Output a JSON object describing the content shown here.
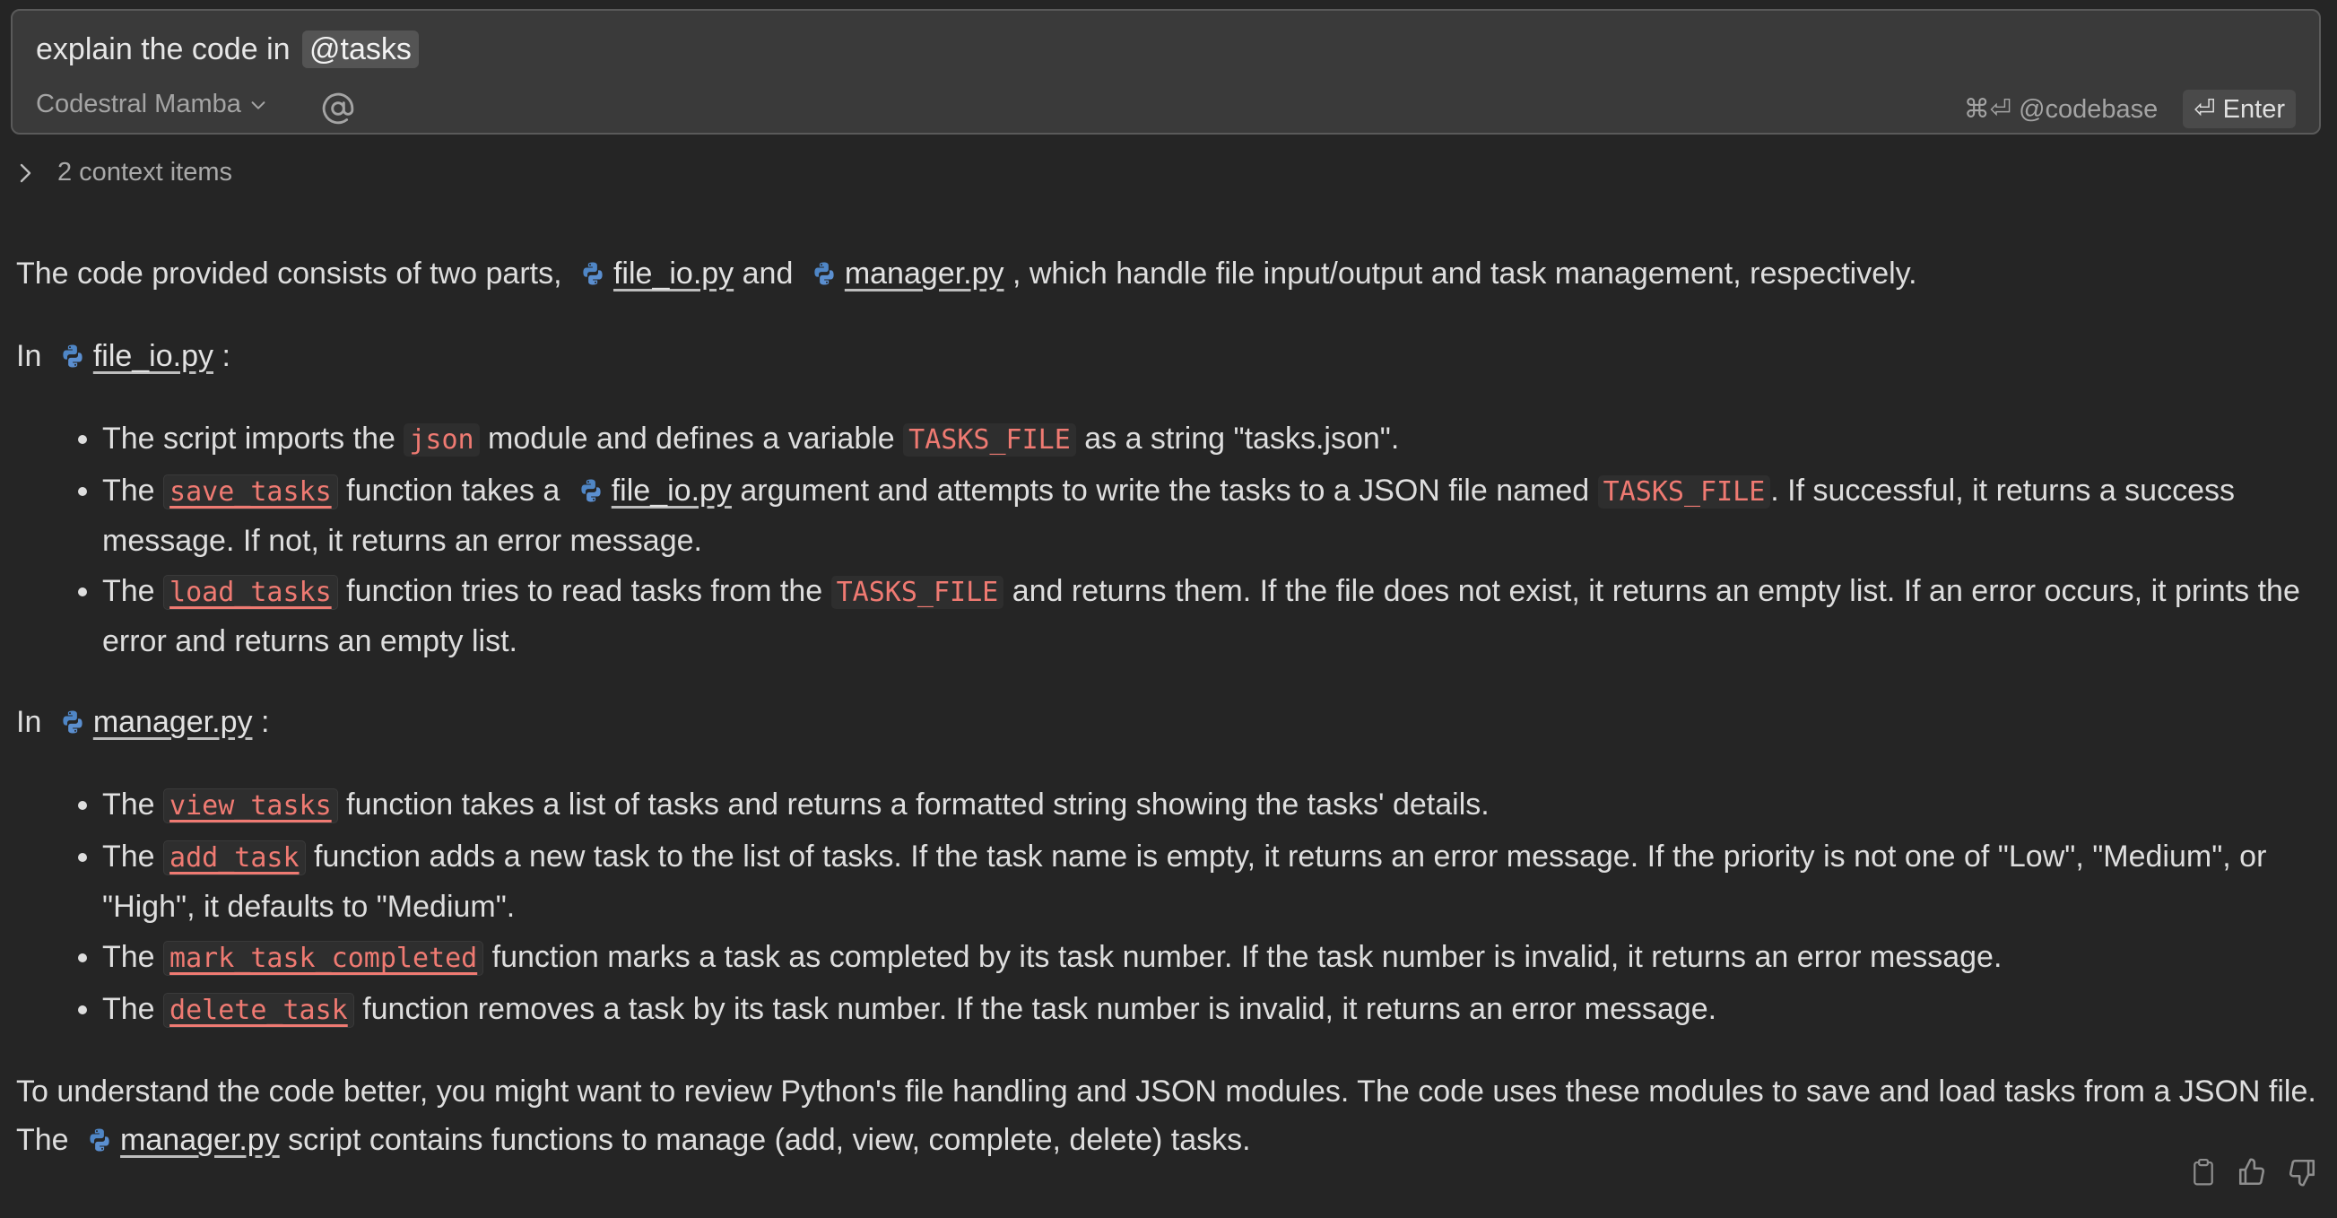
{
  "input": {
    "prompt_text": "explain the code in",
    "mention": "@tasks",
    "model": "Codestral Mamba",
    "at_symbol": "@",
    "codebase_shortcut": "⌘⏎ @codebase",
    "enter_label": "⏎ Enter"
  },
  "context": {
    "label": "2 context items"
  },
  "response": {
    "intro": {
      "a": "The code provided consists of two parts,",
      "file1": "file_io.py",
      "b": "and",
      "file2": "manager.py",
      "c": ", which handle file input/output and task management, respectively."
    },
    "section1": {
      "prefix": "In",
      "file": "file_io.py",
      "suffix": ":",
      "bullets": [
        {
          "t1": "The script imports the",
          "c1": "json",
          "t2": "module and defines a variable",
          "c2": "TASKS_FILE",
          "t3": "as a string \"tasks.json\"."
        },
        {
          "t1": "The",
          "c1": "save_tasks",
          "t2": "function takes a",
          "file": "file_io.py",
          "t3": "argument and attempts to write the tasks to a JSON file named",
          "c2": "TASKS_FILE",
          "t4": ". If successful, it returns a success message. If not, it returns an error message."
        },
        {
          "t1": "The",
          "c1": "load_tasks",
          "t2": "function tries to read tasks from the",
          "c2": "TASKS_FILE",
          "t3": "and returns them. If the file does not exist, it returns an empty list. If an error occurs, it prints the error and returns an empty list."
        }
      ]
    },
    "section2": {
      "prefix": "In",
      "file": "manager.py",
      "suffix": ":",
      "bullets": [
        {
          "t1": "The",
          "c1": "view_tasks",
          "t2": "function takes a list of tasks and returns a formatted string showing the tasks' details."
        },
        {
          "t1": "The",
          "c1": "add_task",
          "t2": "function adds a new task to the list of tasks. If the task name is empty, it returns an error message. If the priority is not one of \"Low\", \"Medium\", or \"High\", it defaults to \"Medium\"."
        },
        {
          "t1": "The",
          "c1": "mark_task_completed",
          "t2": "function marks a task as completed by its task number. If the task number is invalid, it returns an error message."
        },
        {
          "t1": "The",
          "c1": "delete_task",
          "t2": "function removes a task by its task number. If the task number is invalid, it returns an error message."
        }
      ]
    },
    "outro": {
      "a": "To understand the code better, you might want to review Python's file handling and JSON modules. The code uses these modules to save and load tasks from a JSON file. The",
      "file": "manager.py",
      "b": "script contains functions to manage (add, view, complete, delete) tasks."
    }
  },
  "feedback_icons": [
    "clipboard-icon",
    "thumbs-up-icon",
    "thumbs-down-icon"
  ],
  "colors": {
    "background": "#252525",
    "input_background": "#3a3a3a",
    "code_text": "#ef7a72",
    "python_icon_blue": "#4f86c6"
  }
}
